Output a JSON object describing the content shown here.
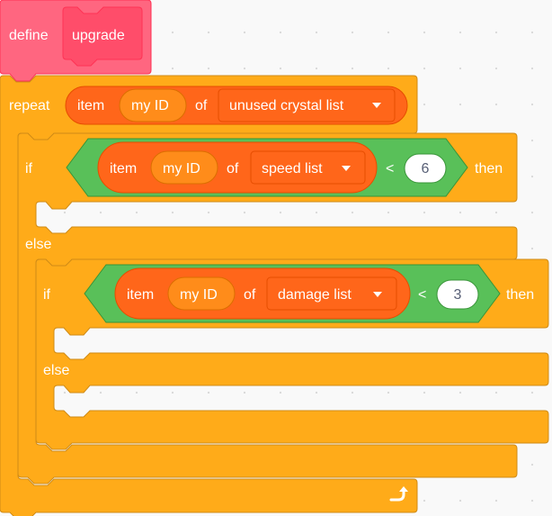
{
  "define_block": {
    "keyword": "define",
    "name": "upgrade"
  },
  "repeat_block": {
    "keyword": "repeat",
    "count_reporter": {
      "item_label": "item",
      "index_var": "my ID",
      "of_label": "of",
      "list_name": "unused crystal list"
    }
  },
  "if_speed": {
    "if_label": "if",
    "then_label": "then",
    "else_label": "else",
    "condition": {
      "item_label": "item",
      "index_var": "my ID",
      "of_label": "of",
      "list_name": "speed list",
      "operator": "<",
      "value": "6"
    }
  },
  "if_damage": {
    "if_label": "if",
    "then_label": "then",
    "else_label": "else",
    "condition": {
      "item_label": "item",
      "index_var": "my ID",
      "of_label": "of",
      "list_name": "damage list",
      "operator": "<",
      "value": "3"
    }
  },
  "colors": {
    "control": "#ffab19",
    "control_border": "#cf8b17",
    "list": "#ff661a",
    "list_border": "#e64d00",
    "variable": "#ff8c1a",
    "operator": "#59c059",
    "operator_border": "#389438",
    "my_blocks": "#ff6680",
    "my_blocks_dark": "#ff4d6a",
    "my_blocks_border": "#ff3355"
  }
}
